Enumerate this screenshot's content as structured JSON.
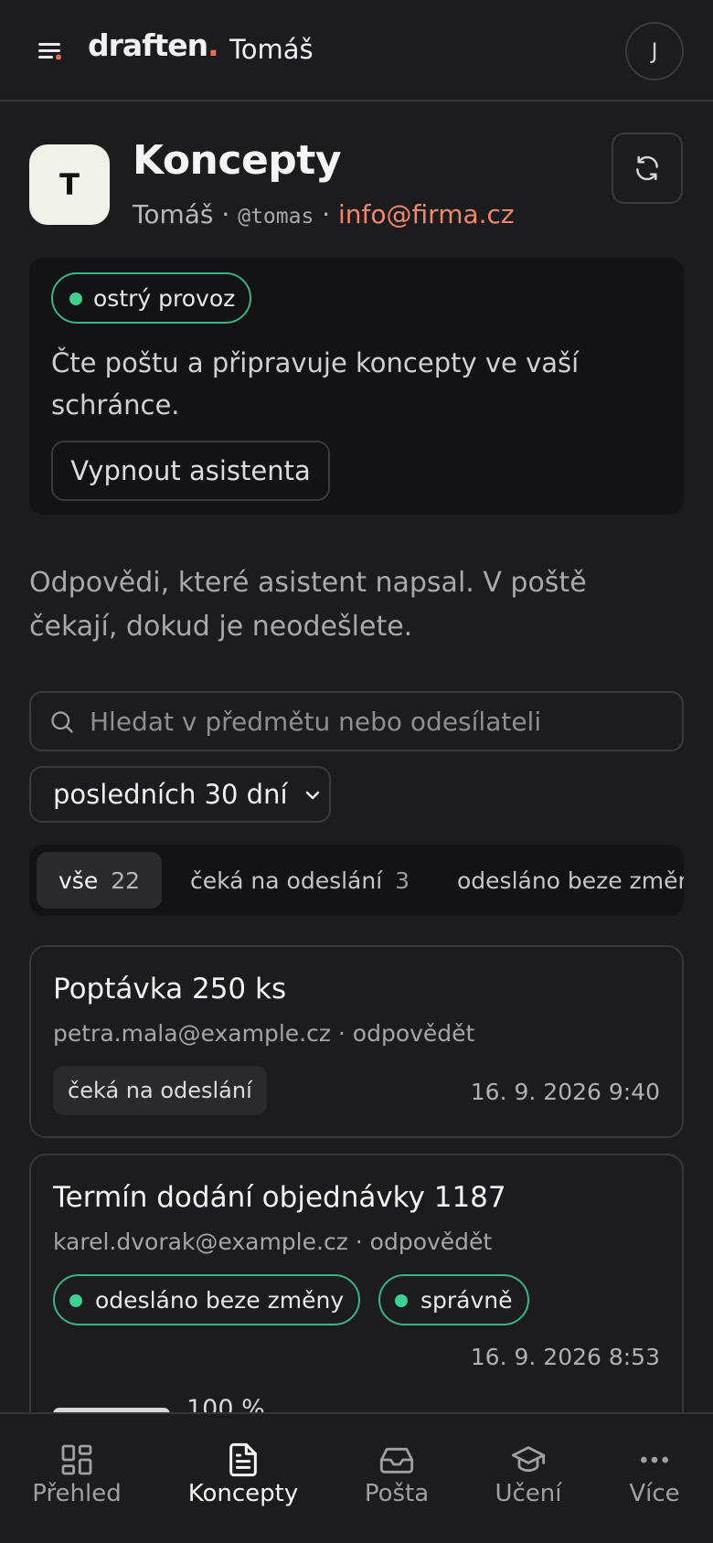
{
  "header": {
    "brand": "draften",
    "brand_dot": ".",
    "user_name": "Tomáš",
    "avatar_initial": "J"
  },
  "profile": {
    "initial": "T",
    "title": "Koncepty",
    "name": "Tomáš",
    "separator": "·",
    "handle": "@tomas",
    "email": "info@firma.cz"
  },
  "status_card": {
    "badge": "ostrý provoz",
    "description": "Čte poštu a připravuje koncepty ve vaší schránce.",
    "button": "Vypnout asistenta"
  },
  "intro": "Odpovědi, které asistent napsal. V poště čekají, dokud je neodešlete.",
  "search": {
    "placeholder": "Hledat v předmětu nebo odesílateli",
    "value": ""
  },
  "range_select": {
    "selected": "posledních 30 dní"
  },
  "filter_tabs": [
    {
      "label": "vše",
      "count": "22",
      "active": true
    },
    {
      "label": "čeká na odeslání",
      "count": "3",
      "active": false
    },
    {
      "label": "odesláno beze změny",
      "count": "",
      "active": false
    }
  ],
  "drafts": [
    {
      "subject": "Poptávka 250 ks",
      "meta": "petra.mala@example.cz · odpovědět",
      "status": "čeká na odeslání",
      "date": "16. 9. 2026 9:40"
    },
    {
      "subject": "Termín dodání objednávky 1187",
      "meta": "karel.dvorak@example.cz · odpovědět",
      "status": "odesláno beze změny",
      "verdict": "správně",
      "date": "16. 9. 2026 8:53",
      "similarity_label": "100 %",
      "similarity": 1.0
    }
  ],
  "bottom_nav": [
    {
      "label": "Přehled",
      "icon": "grid-icon",
      "active": false
    },
    {
      "label": "Koncepty",
      "icon": "document-icon",
      "active": true
    },
    {
      "label": "Pošta",
      "icon": "inbox-icon",
      "active": false
    },
    {
      "label": "Učení",
      "icon": "graduation-cap-icon",
      "active": false
    },
    {
      "label": "Více",
      "icon": "more-dots-icon",
      "active": false
    }
  ],
  "colors": {
    "background": "#1c1c1f",
    "accent_green": "#3fcf8e",
    "email_accent": "#f2876d",
    "brand_dot": "#ef6b5b"
  }
}
